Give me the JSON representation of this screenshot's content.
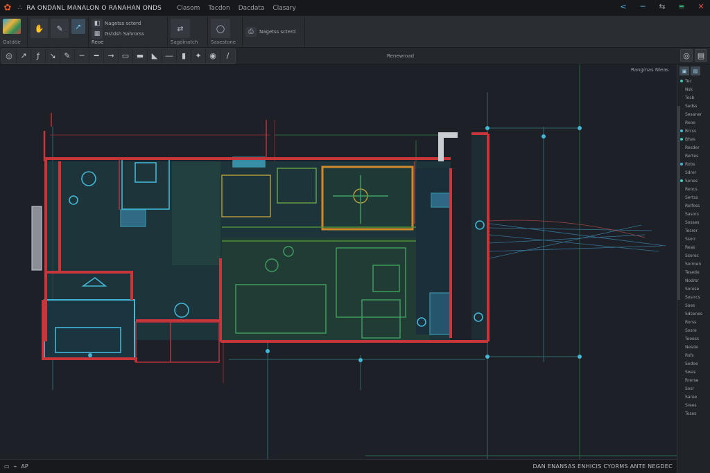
{
  "titlebar": {
    "app_title": "RA ONDANL MANALON O RANAHAN ONDS",
    "menu": [
      "Clasom",
      "Tacdon",
      "Dacdata",
      "Clasary"
    ],
    "controls": {
      "back": "<",
      "restore": "─",
      "sync": "⇆",
      "menu": "≡",
      "close": "✕"
    }
  },
  "ribbon": {
    "group1_label": "Oatdde",
    "line1": "Nagetss scterd",
    "line2": "Gstdsh Sahrorss",
    "line3": "Reoe",
    "group4_label": "Sagdinatch",
    "group5_label": "Sasestone"
  },
  "toolstrip": {
    "tools_left": [
      "◎",
      "↗",
      "ƒ",
      "↘",
      "✎",
      "─",
      "━",
      "→",
      "▭",
      "▬",
      "◣",
      "―",
      "▮",
      "✦",
      "◉",
      "∕"
    ],
    "center_label": "Renewroad",
    "tools_right": [
      "◎",
      "▤"
    ]
  },
  "canvas": {
    "corner_label": "Rangmas Nleas"
  },
  "palette": {
    "header_glyphs": [
      "▣",
      "▧"
    ],
    "items": [
      {
        "label": "Tec",
        "color": "#2fd1c0"
      },
      {
        "label": "Nsk",
        "color": ""
      },
      {
        "label": "Tosb",
        "color": ""
      },
      {
        "label": "Sedss",
        "color": ""
      },
      {
        "label": "Sesaner",
        "color": ""
      },
      {
        "label": "Reoe",
        "color": ""
      },
      {
        "label": "Brcss",
        "color": "#35c5d6"
      },
      {
        "label": "Bhes",
        "color": "#2fd1c0"
      },
      {
        "label": "Resder",
        "color": ""
      },
      {
        "label": "Rertes",
        "color": ""
      },
      {
        "label": "Robs",
        "color": "#4ab0e0"
      },
      {
        "label": "Sdrer",
        "color": ""
      },
      {
        "label": "Senes",
        "color": "#2fd1c0"
      },
      {
        "label": "Reocs",
        "color": ""
      },
      {
        "label": "Sertss",
        "color": ""
      },
      {
        "label": "Relfoss",
        "color": ""
      },
      {
        "label": "Sasors",
        "color": ""
      },
      {
        "label": "Sosses",
        "color": ""
      },
      {
        "label": "Tesrer",
        "color": ""
      },
      {
        "label": "Ssorr",
        "color": ""
      },
      {
        "label": "Reas",
        "color": ""
      },
      {
        "label": "Ssorec",
        "color": ""
      },
      {
        "label": "Sormen",
        "color": ""
      },
      {
        "label": "Tesede",
        "color": ""
      },
      {
        "label": "Nodrsr",
        "color": ""
      },
      {
        "label": "Sorese",
        "color": ""
      },
      {
        "label": "Sosrrcs",
        "color": ""
      },
      {
        "label": "Soes",
        "color": ""
      },
      {
        "label": "Sdsenes",
        "color": ""
      },
      {
        "label": "Rorss",
        "color": ""
      },
      {
        "label": "Sosre",
        "color": ""
      },
      {
        "label": "Teoess",
        "color": ""
      },
      {
        "label": "Nesde",
        "color": ""
      },
      {
        "label": "Rsfs",
        "color": ""
      },
      {
        "label": "Sedoe",
        "color": ""
      },
      {
        "label": "Swas",
        "color": ""
      },
      {
        "label": "Rrerse",
        "color": ""
      },
      {
        "label": "Sosr",
        "color": ""
      },
      {
        "label": "Saree",
        "color": ""
      },
      {
        "label": "Srees",
        "color": ""
      },
      {
        "label": "Toses",
        "color": ""
      }
    ]
  },
  "statusbar": {
    "left_glyphs": [
      "▭",
      "⌁"
    ],
    "left_text": "AP",
    "right_text": "DAN ENANSAS ENHICIS CYORMS ANTE NEGDEC"
  },
  "colors": {
    "wall_red": "#c7363a",
    "cyan": "#43b7d6",
    "green": "#3fa260",
    "orange": "#d08a2e",
    "teal_fill": "#1f5a5c"
  }
}
